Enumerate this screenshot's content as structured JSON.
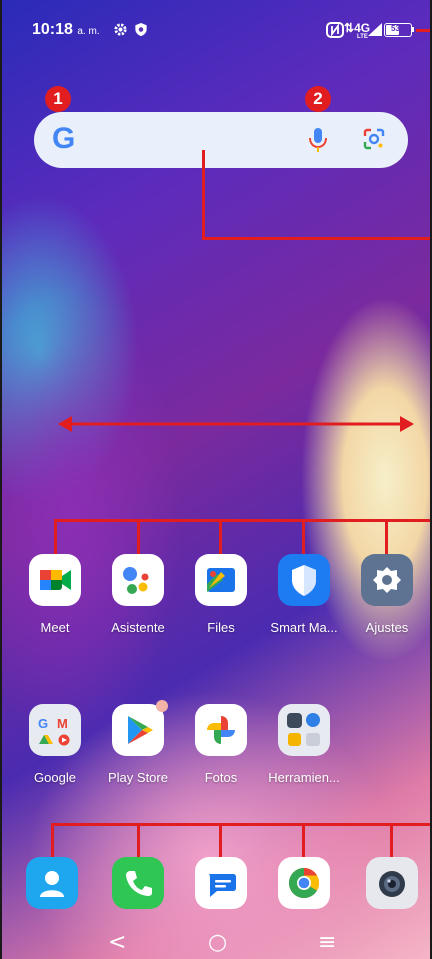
{
  "status_bar": {
    "time": "10:18",
    "time_suffix": "a. m.",
    "network": "4G",
    "network_sub": "LTE",
    "battery": "53"
  },
  "callouts": {
    "one": "1",
    "two": "2"
  },
  "search_bar": {
    "logo": "G"
  },
  "apps_row1": [
    {
      "label": "Meet",
      "icon": "meet-icon"
    },
    {
      "label": "Asistente",
      "icon": "assistant-icon"
    },
    {
      "label": "Files",
      "icon": "files-icon"
    },
    {
      "label": "Smart Ma...",
      "icon": "shield-icon"
    },
    {
      "label": "Ajustes",
      "icon": "settings-icon"
    }
  ],
  "apps_row2": [
    {
      "label": "Google",
      "icon": "google-folder-icon"
    },
    {
      "label": "Play Store",
      "icon": "play-store-icon"
    },
    {
      "label": "Fotos",
      "icon": "photos-icon"
    },
    {
      "label": "Herramien...",
      "icon": "tools-folder-icon"
    }
  ],
  "dock": [
    {
      "icon": "contacts-icon"
    },
    {
      "icon": "phone-icon"
    },
    {
      "icon": "messages-icon"
    },
    {
      "icon": "chrome-icon"
    },
    {
      "icon": "camera-icon"
    }
  ],
  "nav": {
    "back": "<",
    "home": "○",
    "recents": "≡"
  },
  "colors": {
    "annotation_red": "#e21d20",
    "search_bg": "#eaf0fb"
  }
}
